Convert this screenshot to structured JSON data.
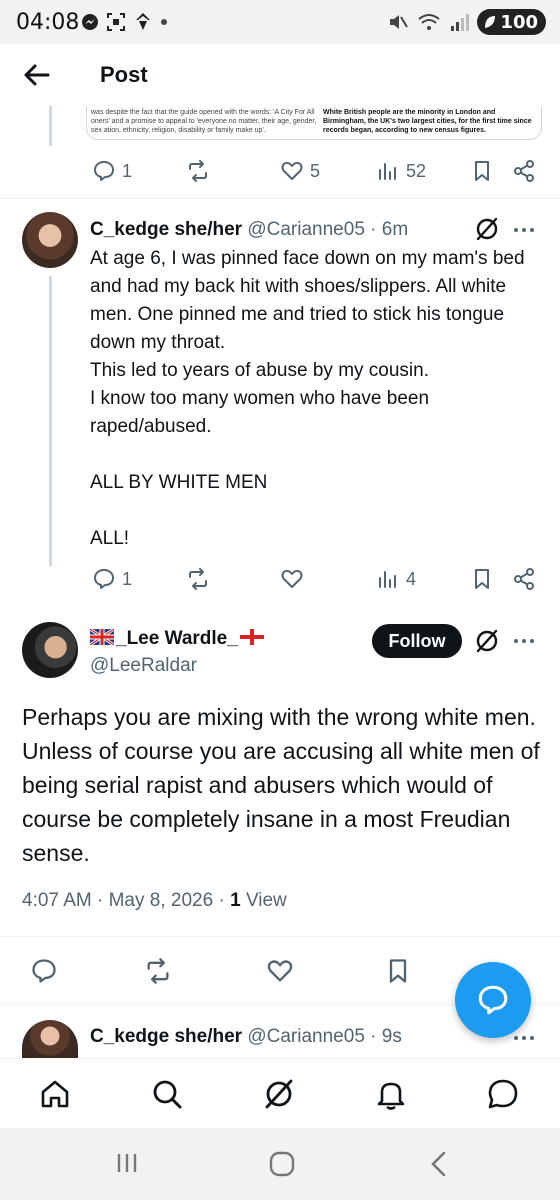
{
  "status_bar": {
    "time": "04:08",
    "battery": "100"
  },
  "header": {
    "title": "Post"
  },
  "quoted_preview": {
    "left_text": "was despite the fact that the guide opened with the words: 'A City For All oners' and a promise to appeal to 'everyone no matter, their age, gender, sex ation, ethnicity, religion, disability or family make up'.",
    "right_text": "White British people are the minority in London and Birmingham, the UK's two largest cities, for the first time since records began, according to new census figures."
  },
  "prev_actions": {
    "replies": "1",
    "likes": "5",
    "views": "52"
  },
  "reply1": {
    "name": "C_kedge she/her",
    "handle": "@Carianne05",
    "time": "· 6m",
    "text": "At age 6, I was pinned face down on my mam's bed and had my back hit with shoes/slippers. All white men. One pinned me and tried to stick his tongue down my throat.\nThis led to years of abuse by my cousin.\nI know too many women who have been raped/abused.\n\nALL BY WHITE MEN\n\nALL!",
    "replies": "1",
    "views": "4"
  },
  "main_post": {
    "name": "_Lee Wardle_",
    "handle": "@LeeRaldar",
    "follow_label": "Follow",
    "text": "Perhaps you are mixing with the wrong white men. Unless of course you are accusing all white men of being serial rapist and abusers which would of course be completely insane in a most Freudian sense.",
    "time": "4:07 AM",
    "date": "May 8, 2026",
    "views_count": "1",
    "views_label": "View"
  },
  "reply2": {
    "name": "C_kedge she/her",
    "handle": "@Carianne05",
    "time": "· 9s"
  },
  "colors": {
    "accent": "#1d9bf0",
    "text": "#0f1419",
    "muted": "#536471"
  }
}
